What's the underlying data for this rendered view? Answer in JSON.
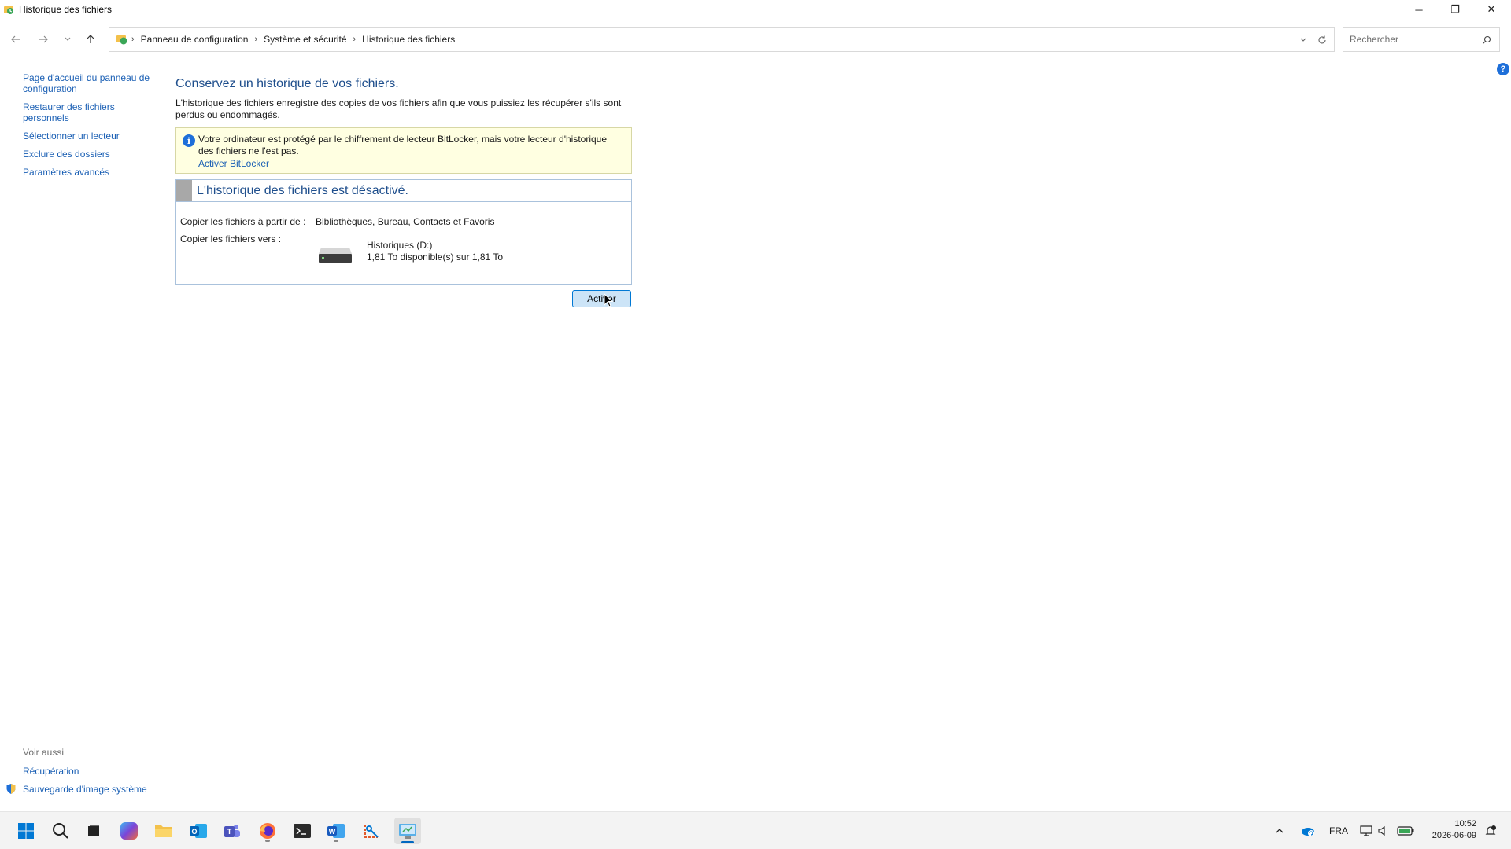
{
  "window": {
    "title": "Historique des fichiers",
    "minimize_glyph": "─",
    "restore_glyph": "❐",
    "close_glyph": "✕"
  },
  "nav": {
    "back_icon": "arrow-left-icon",
    "forward_icon": "arrow-right-icon",
    "recent_icon": "chevron-down-icon",
    "up_icon": "arrow-up-icon",
    "breadcrumbs": [
      "Panneau de configuration",
      "Système et sécurité",
      "Historique des fichiers"
    ],
    "search_placeholder": "Rechercher"
  },
  "sidebar": {
    "links": [
      "Page d'accueil du panneau de configuration",
      "Restaurer des fichiers personnels",
      "Sélectionner un lecteur",
      "Exclure des dossiers",
      "Paramètres avancés"
    ],
    "see_also_header": "Voir aussi",
    "see_also": [
      "Récupération",
      "Sauvegarde d'image système"
    ]
  },
  "main": {
    "heading": "Conservez un historique de vos fichiers.",
    "description": "L'historique des fichiers enregistre des copies de vos fichiers afin que vous puissiez les récupérer s'ils sont perdus ou endommagés.",
    "warning_text": "Votre ordinateur est protégé par le chiffrement de lecteur BitLocker, mais votre lecteur d'historique des fichiers ne l'est pas.",
    "warning_link": "Activer BitLocker",
    "status_title": "L'historique des fichiers est désactivé.",
    "copy_from_label": "Copier les fichiers à partir de :",
    "copy_from_value": "Bibliothèques, Bureau, Contacts et Favoris",
    "copy_to_label": "Copier les fichiers vers :",
    "drive_name": "Historiques (D:)",
    "drive_space": "1,81 To disponible(s) sur 1,81 To",
    "activate_button": "Activer"
  },
  "taskbar": {
    "language": "FRA",
    "time": "10:52",
    "date": "2026-06-09"
  },
  "colors": {
    "accent": "#0078d4",
    "link": "#1a5fb4",
    "heading": "#1e4e8c",
    "warning_bg": "#ffffe1"
  }
}
